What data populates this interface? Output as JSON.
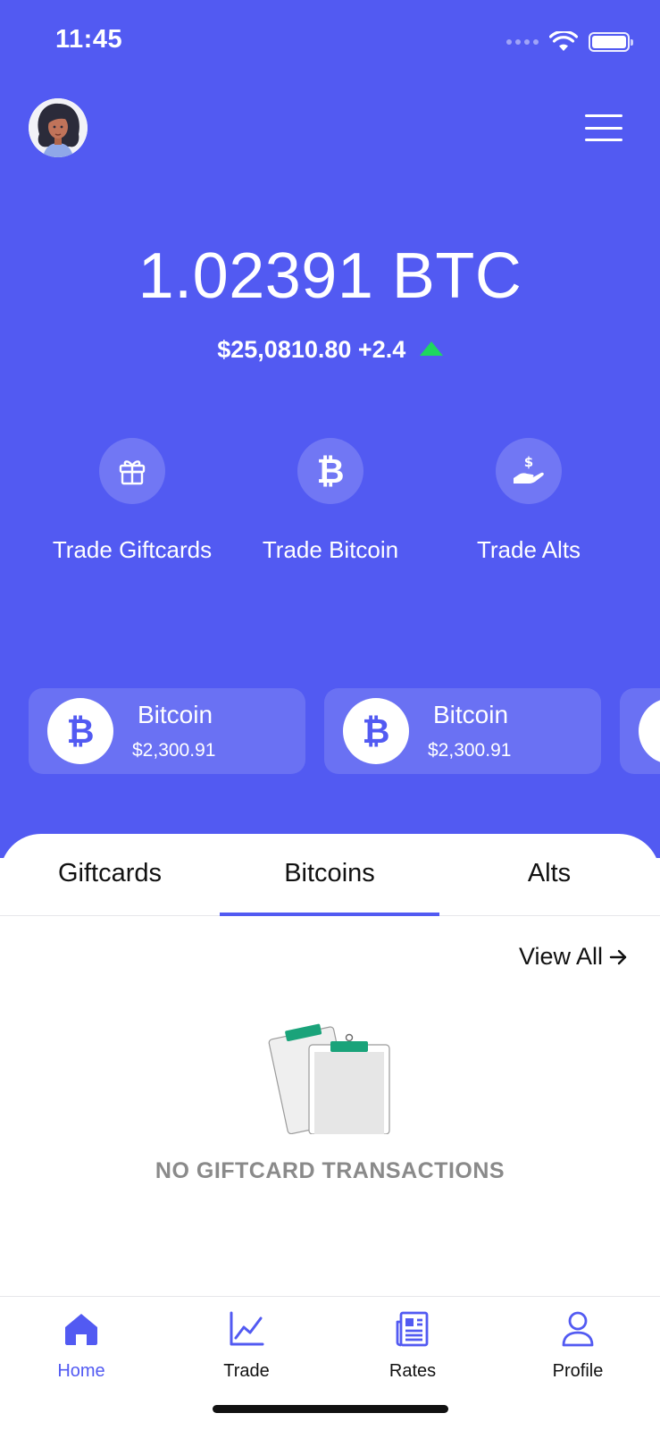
{
  "colors": {
    "brand": "#525AF2",
    "positive": "#1ED760",
    "muted_text": "#8A8A8A"
  },
  "status_bar": {
    "time": "11:45"
  },
  "header": {
    "avatar_icon": "user-avatar",
    "menu_icon": "hamburger-menu-icon"
  },
  "wallet": {
    "balance": "1.02391 BTC",
    "fiat_value": "$25,0810.80",
    "change": "+2.4",
    "trend": "up"
  },
  "actions": [
    {
      "label": "Trade Giftcards",
      "icon": "gift-icon"
    },
    {
      "label": "Trade Bitcoin",
      "icon": "bitcoin-icon"
    },
    {
      "label": "Trade Alts",
      "icon": "hand-dollar-icon"
    }
  ],
  "coins": [
    {
      "name": "Bitcoin",
      "price": "$2,300.91",
      "icon": "bitcoin-icon"
    },
    {
      "name": "Bitcoin",
      "price": "$2,300.91",
      "icon": "bitcoin-icon"
    }
  ],
  "tabs": [
    {
      "label": "Giftcards",
      "active": false
    },
    {
      "label": "Bitcoins",
      "active": true
    },
    {
      "label": "Alts",
      "active": false
    }
  ],
  "transactions": {
    "view_all_label": "View All",
    "empty_message": "NO GIFTCARD TRANSACTIONS",
    "empty_icon": "clipboard-illustration"
  },
  "bottom_nav": [
    {
      "label": "Home",
      "icon": "home-icon",
      "active": true
    },
    {
      "label": "Trade",
      "icon": "chart-line-icon",
      "active": false
    },
    {
      "label": "Rates",
      "icon": "newspaper-icon",
      "active": false
    },
    {
      "label": "Profile",
      "icon": "person-icon",
      "active": false
    }
  ]
}
